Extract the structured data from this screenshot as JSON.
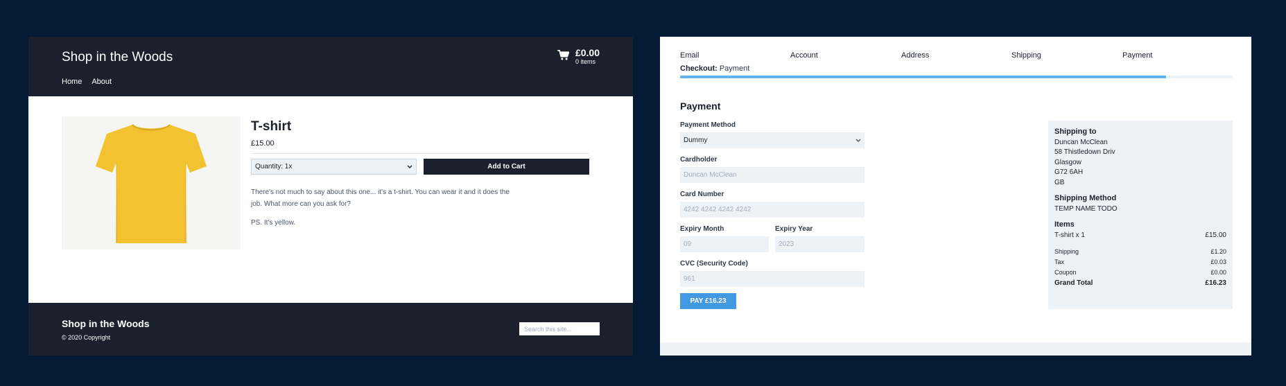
{
  "shop": {
    "brand": "Shop in the Woods",
    "nav": [
      "Home",
      "About"
    ],
    "cart": {
      "total": "£0.00",
      "count": "0 items"
    },
    "product": {
      "title": "T-shirt",
      "price": "£15.00",
      "quantity": "Quantity: 1x",
      "add_to_cart": "Add to Cart",
      "description": [
        "There's not much to say about this one... it's a t-shirt. You can wear it and it does the job. What more can you ask for?",
        "PS. It's yellow."
      ],
      "shirt_color": "#f2c230"
    },
    "footer": {
      "brand": "Shop in the Woods",
      "copyright": "© 2020 Copyright",
      "search_placeholder": "Search this site..."
    }
  },
  "checkout": {
    "steps": [
      "Email",
      "Account",
      "Address",
      "Shipping",
      "Payment"
    ],
    "label_prefix": "Checkout:",
    "label_step": "Payment",
    "progress": 0.88,
    "heading": "Payment",
    "fields": {
      "payment_method": {
        "label": "Payment Method",
        "value": "Dummy"
      },
      "cardholder": {
        "label": "Cardholder",
        "placeholder": "Duncan McClean"
      },
      "card_number": {
        "label": "Card Number",
        "placeholder": "4242 4242 4242 4242"
      },
      "expiry_month": {
        "label": "Expiry Month",
        "placeholder": "09"
      },
      "expiry_year": {
        "label": "Expiry Year",
        "placeholder": "2023"
      },
      "cvc": {
        "label": "CVC (Security Code)",
        "placeholder": "961"
      }
    },
    "pay_button": "PAY £16.23",
    "summary": {
      "shipping_to_heading": "Shipping to",
      "address": [
        "Duncan McClean",
        "58 Thistledown Driv",
        "Glasgow",
        "G72 6AH",
        "GB"
      ],
      "shipping_method_heading": "Shipping Method",
      "shipping_method": "TEMP NAME TODO",
      "items_heading": "Items",
      "item": {
        "name": "T-shirt x 1",
        "price": "£15.00"
      },
      "shipping": {
        "label": "Shipping",
        "value": "£1.20"
      },
      "tax": {
        "label": "Tax",
        "value": "£0.03"
      },
      "coupon": {
        "label": "Coupon",
        "value": "£0.00"
      },
      "grand_total": {
        "label": "Grand Total",
        "value": "£16.23"
      }
    },
    "accent": "#4299e1"
  }
}
